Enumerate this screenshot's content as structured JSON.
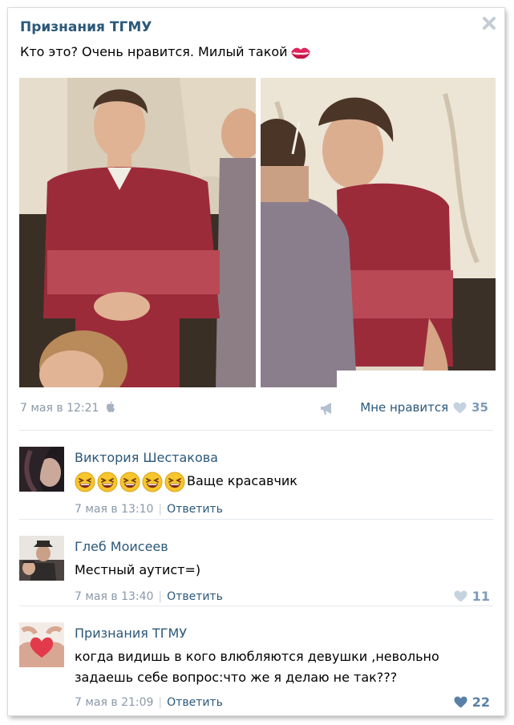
{
  "post": {
    "title": "Признания ТГМУ",
    "text": "Кто это? Очень нравится. Милый такой",
    "date": "7 мая в 12:21",
    "like_label": "Мне нравится",
    "like_count": "35",
    "icons": [
      "close-icon",
      "kiss-icon",
      "phone-icon",
      "megaphone-icon",
      "heart-icon"
    ]
  },
  "comments": [
    {
      "author": "Виктория Шестакова",
      "text": "Ваще красавчик",
      "emoji_count": 5,
      "date": "7 мая в 13:10",
      "reply": "Ответить",
      "likes": ""
    },
    {
      "author": "Глеб Моисеев",
      "text": "Местный аутист=)",
      "date": "7 мая в 13:40",
      "reply": "Ответить",
      "likes": "11"
    },
    {
      "author": "Признания ТГМУ",
      "text_line1": "когда видишь в кого влюбляются девушки ,невольно",
      "text_line2": "задаешь себе вопрос:что же я делаю не так???",
      "date": "7 мая в 21:09",
      "reply": "Ответить",
      "likes": "22"
    }
  ],
  "colors": {
    "link": "#2b587a",
    "meta": "#8a98a8",
    "like": "#7f9bb8"
  }
}
